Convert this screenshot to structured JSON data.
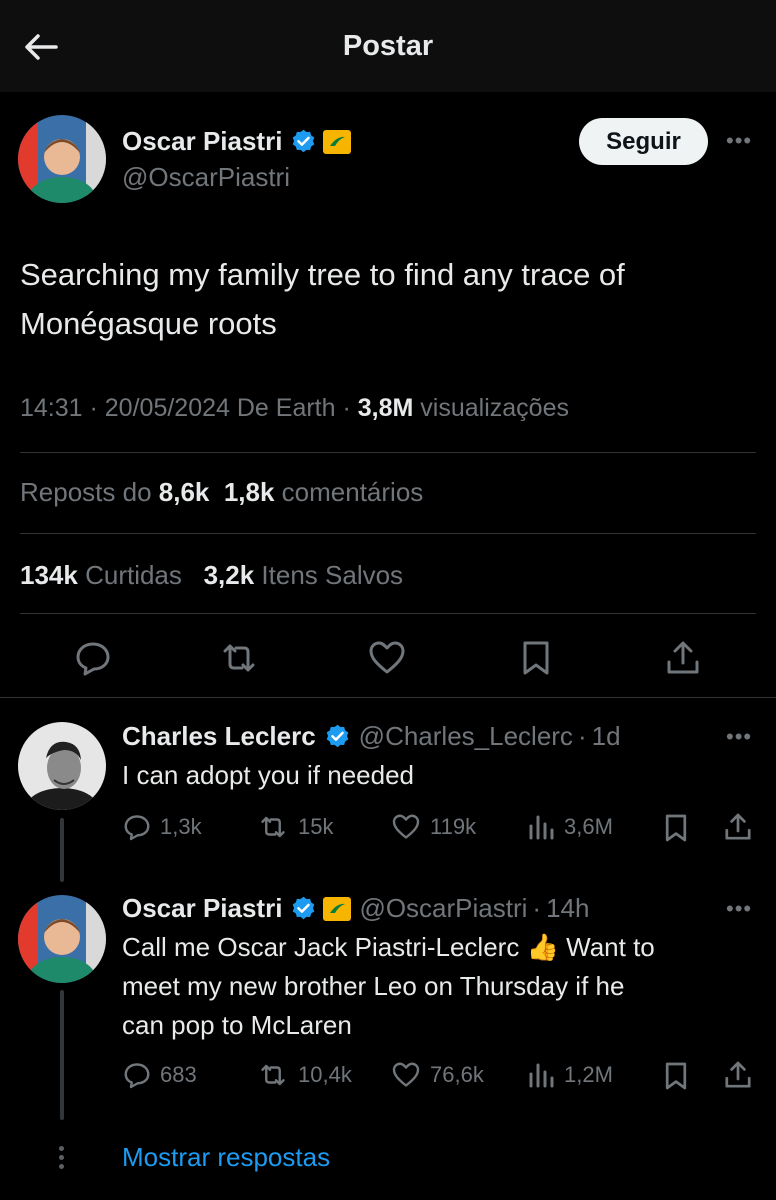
{
  "header": {
    "title": "Postar"
  },
  "tweet": {
    "author_name": "Oscar Piastri",
    "author_handle": "@OscarPiastri",
    "follow_label": "Seguir",
    "text": "Searching my family tree to find any trace of Monégasque roots",
    "time": "14:31",
    "date": "20/05/2024",
    "source": "De Earth",
    "views_count": "3,8M",
    "views_label": "visualizações",
    "reposts_label": "Reposts do",
    "reposts_count": "8,6k",
    "comments_count": "1,8k",
    "comments_label": "comentários",
    "likes_count": "134k",
    "likes_label": "Curtidas",
    "saves_count": "3,2k",
    "saves_label": "Itens Salvos"
  },
  "replies": [
    {
      "name": "Charles Leclerc",
      "handle": "@Charles_Leclerc",
      "time": "1d",
      "text": "I can adopt you if needed",
      "replies": "1,3k",
      "reposts": "15k",
      "likes": "119k",
      "views": "3,6M"
    },
    {
      "name": "Oscar Piastri",
      "handle": "@OscarPiastri",
      "time": "14h",
      "text_lines": [
        "Call me Oscar Jack Piastri-Leclerc 👍 Want to",
        "meet my new brother Leo on Thursday if he",
        "can pop to McLaren"
      ],
      "replies": "683",
      "reposts": "10,4k",
      "likes": "76,6k",
      "views": "1,2M"
    }
  ],
  "show_replies_label": "Mostrar respostas",
  "colors": {
    "accent": "#1d9bf0",
    "background": "#000000",
    "muted": "#71767b",
    "affiliate_badge": "#f7b500"
  }
}
